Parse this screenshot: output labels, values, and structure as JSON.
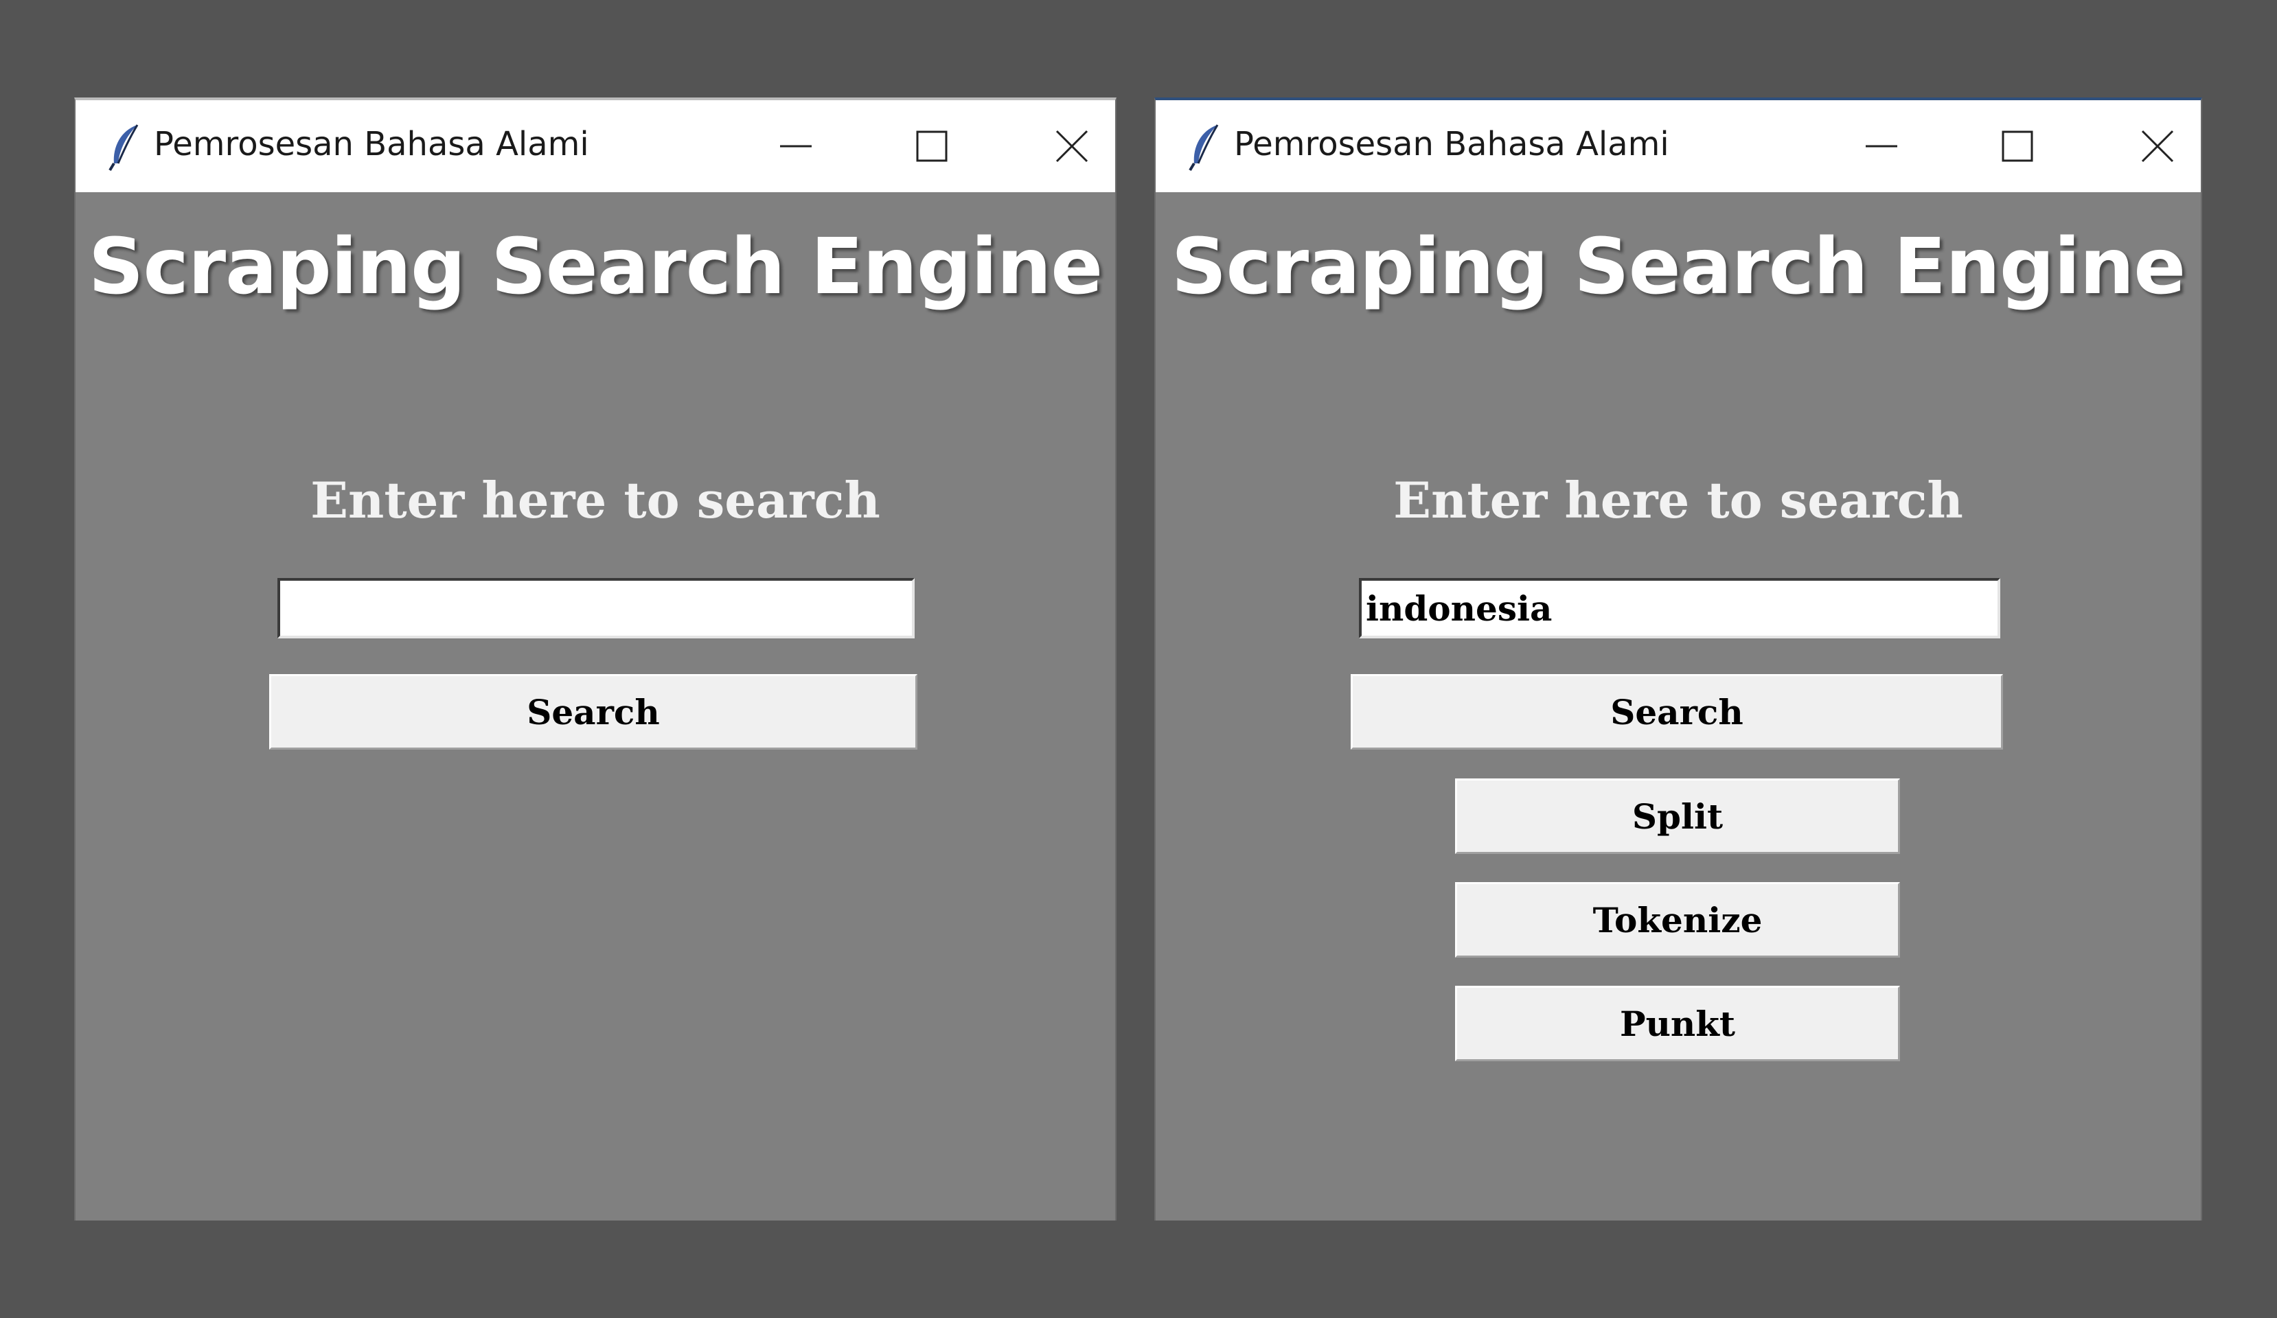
{
  "windows": [
    {
      "title": "Pemrosesan Bahasa Alami",
      "app_title": "Scraping Search Engine",
      "prompt_label": "Enter here to search",
      "search_value": "",
      "buttons": {
        "search": "Search"
      }
    },
    {
      "title": "Pemrosesan Bahasa Alami",
      "app_title": "Scraping Search Engine",
      "prompt_label": "Enter here to search",
      "search_value": "indonesia",
      "buttons": {
        "search": "Search",
        "split": "Split",
        "tokenize": "Tokenize",
        "punkt": "Punkt"
      }
    }
  ],
  "icons": {
    "app": "feather-icon",
    "minimize": "minimize-icon",
    "maximize": "maximize-icon",
    "close": "close-icon"
  },
  "colors": {
    "desktop": "#545454",
    "window_body": "#808080",
    "titlebar": "#ffffff",
    "button_face": "#f0f0f0",
    "heading_text": "#ffffff",
    "active_border": "#2e4f7d"
  }
}
